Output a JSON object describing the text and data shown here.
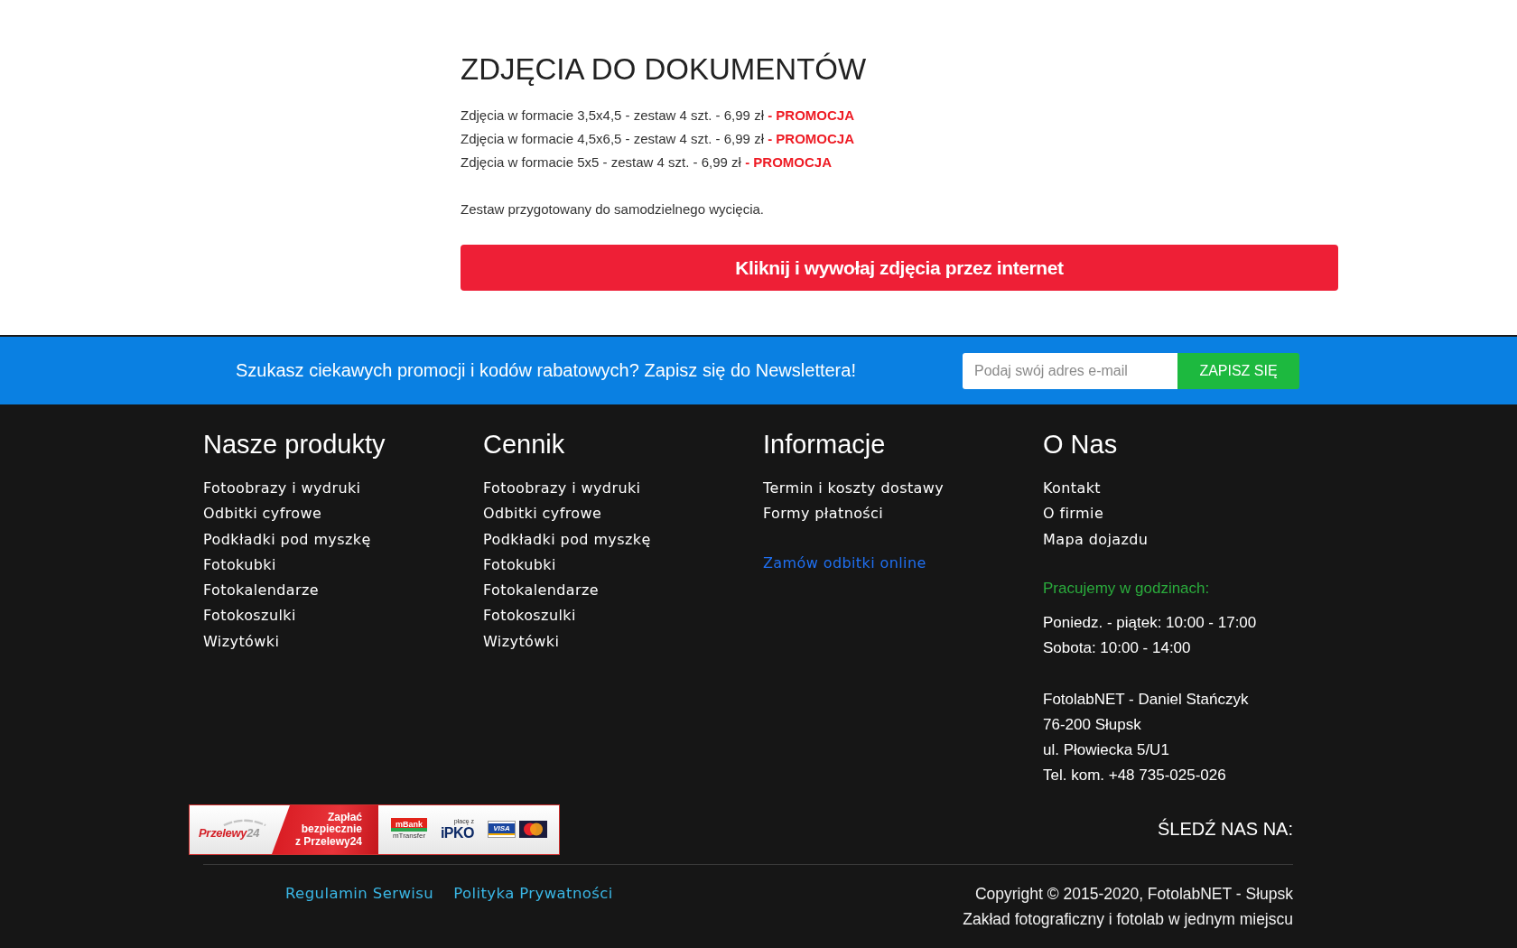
{
  "content": {
    "heading": "ZDJĘCIA DO DOKUMENTÓW",
    "offers": [
      {
        "text": "Zdjęcia w formacie 3,5x4,5 - zestaw 4 szt. - 6,99 zł",
        "promo": "- PROMOCJA"
      },
      {
        "text": "Zdjęcia w formacie 4,5x6,5 - zestaw 4 szt. - 6,99 zł",
        "promo": "- PROMOCJA"
      },
      {
        "text": "Zdjęcia w formacie 5x5 - zestaw 4 szt. - 6,99 zł",
        "promo": "- PROMOCJA"
      }
    ],
    "note": "Zestaw przygotowany do samodzielnego wycięcia.",
    "cta_button": "Kliknij i wywołaj zdjęcia przez internet"
  },
  "newsletter": {
    "text": "Szukasz ciekawych promocji i kodów rabatowych? Zapisz się do Newslettera!",
    "email_field": {
      "placeholder": "Podaj swój adres e-mail"
    },
    "button": "ZAPISZ SIĘ"
  },
  "footer": {
    "columns": [
      {
        "heading": "Nasze produkty",
        "blocks": [
          {
            "kind": "links",
            "items": [
              "Fotoobrazy i wydruki",
              "Odbitki cyfrowe",
              "Podkładki pod myszkę",
              "Fotokubki",
              "Fotokalendarze",
              "Fotokoszulki",
              "Wizytówki"
            ]
          }
        ]
      },
      {
        "heading": "Cennik",
        "blocks": [
          {
            "kind": "links",
            "items": [
              "Fotoobrazy i wydruki",
              "Odbitki cyfrowe",
              "Podkładki pod myszkę",
              "Fotokubki",
              "Fotokalendarze",
              "Fotokoszulki",
              "Wizytówki"
            ]
          }
        ]
      },
      {
        "heading": "Informacje",
        "blocks": [
          {
            "kind": "links",
            "items": [
              "Termin i koszty dostawy",
              "Formy płatności"
            ]
          },
          {
            "kind": "highlight_link",
            "text": "Zamów odbitki online"
          }
        ]
      },
      {
        "heading": "O Nas",
        "blocks": [
          {
            "kind": "links",
            "items": [
              "Kontakt",
              "O firmie",
              "Mapa dojazdu"
            ]
          },
          {
            "kind": "caption",
            "text": "Pracujemy w godzinach:"
          },
          {
            "kind": "lines",
            "items": [
              "Poniedz. - piątek: 10:00 - 17:00",
              "Sobota: 10:00 - 14:00"
            ]
          },
          {
            "kind": "lines",
            "items": [
              "FotolabNET - Daniel Stańczyk",
              "76-200 Słupsk",
              "ul. Płowiecka 5/U1",
              "Tel. kom. +48 735-025-026"
            ]
          }
        ]
      }
    ],
    "payment_banner": {
      "brand": {
        "name": "Przelewy",
        "suffix": "24"
      },
      "slogan_lines": [
        "Zapłać",
        "bezpiecznie",
        "z Przelewy24"
      ],
      "methods": [
        {
          "kind": "mbank",
          "label": "mBank",
          "sublabel": "mTransfer"
        },
        {
          "kind": "ipko",
          "prefix": "płacę z",
          "label": "iPKO"
        },
        {
          "kind": "visa",
          "label": "VISA"
        },
        {
          "kind": "mastercard"
        }
      ]
    },
    "follow_label": "ŚLEDŹ NAS NA:",
    "bottom_links": [
      "Regulamin Serwisu",
      "Polityka Prywatności"
    ],
    "copyright_lines": [
      "Copyright © 2015-2020, FotolabNET - Słupsk",
      "Zakład fotograficzny i fotolab w jednym miejscu"
    ]
  }
}
